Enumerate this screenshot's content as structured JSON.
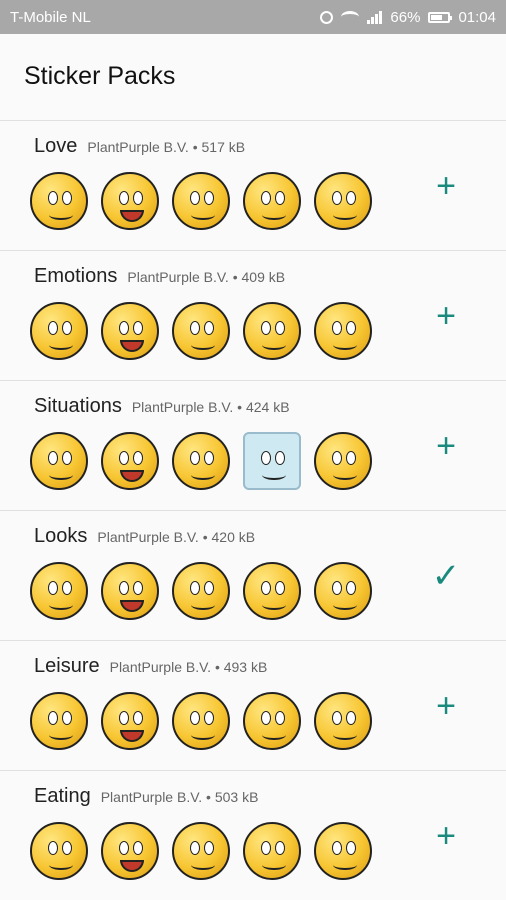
{
  "status": {
    "carrier": "T-Mobile NL",
    "battery": "66%",
    "time": "01:04"
  },
  "title": "Sticker Packs",
  "packs": [
    {
      "name": "Love",
      "meta": "PlantPurple B.V. • 517 kB",
      "action": "add"
    },
    {
      "name": "Emotions",
      "meta": "PlantPurple B.V. • 409 kB",
      "action": "add"
    },
    {
      "name": "Situations",
      "meta": "PlantPurple B.V. • 424 kB",
      "action": "add"
    },
    {
      "name": "Looks",
      "meta": "PlantPurple B.V. • 420 kB",
      "action": "added"
    },
    {
      "name": "Leisure",
      "meta": "PlantPurple B.V. • 493 kB",
      "action": "add"
    },
    {
      "name": "Eating",
      "meta": "PlantPurple B.V. • 503 kB",
      "action": "add"
    }
  ],
  "icons": {
    "add": "plus-icon",
    "added": "check-icon"
  },
  "colors": {
    "accent": "#1a8a7e",
    "statusbar": "#a8a8a8"
  }
}
